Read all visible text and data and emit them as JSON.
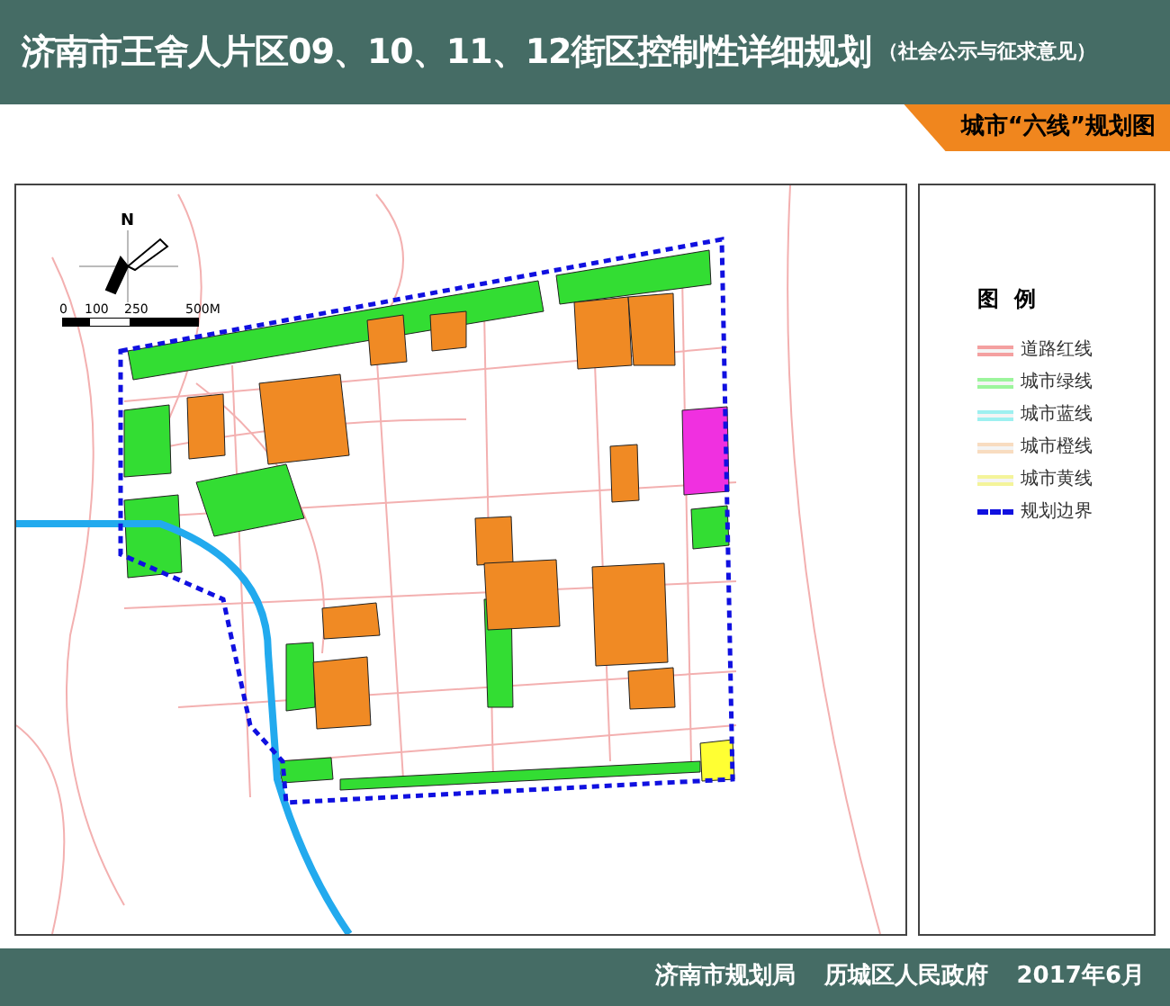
{
  "header": {
    "title": "济南市王舍人片区09、10、11、12街区控制性详细规划",
    "subtitle": "（社会公示与征求意见）"
  },
  "sheet_tab": {
    "label": "城市“六线”规划图"
  },
  "map": {
    "north_label": "N",
    "scale_labels": [
      "0",
      "100",
      "250",
      "500M"
    ]
  },
  "legend": {
    "title": "图  例",
    "items": [
      {
        "label": "道路红线",
        "kind": "double",
        "color": "#f4a0a0"
      },
      {
        "label": "城市绿线",
        "kind": "double",
        "color": "#9cf59c"
      },
      {
        "label": "城市蓝线",
        "kind": "double",
        "color": "#9ef0f0"
      },
      {
        "label": "城市橙线",
        "kind": "double",
        "color": "#f8dcc0"
      },
      {
        "label": "城市黄线",
        "kind": "double",
        "color": "#f4f49a"
      },
      {
        "label": "规划边界",
        "kind": "dashed",
        "color": "#1010e0"
      }
    ]
  },
  "footer": {
    "items": [
      "济南市规划局",
      "历城区人民政府",
      "2017年6月"
    ]
  }
}
